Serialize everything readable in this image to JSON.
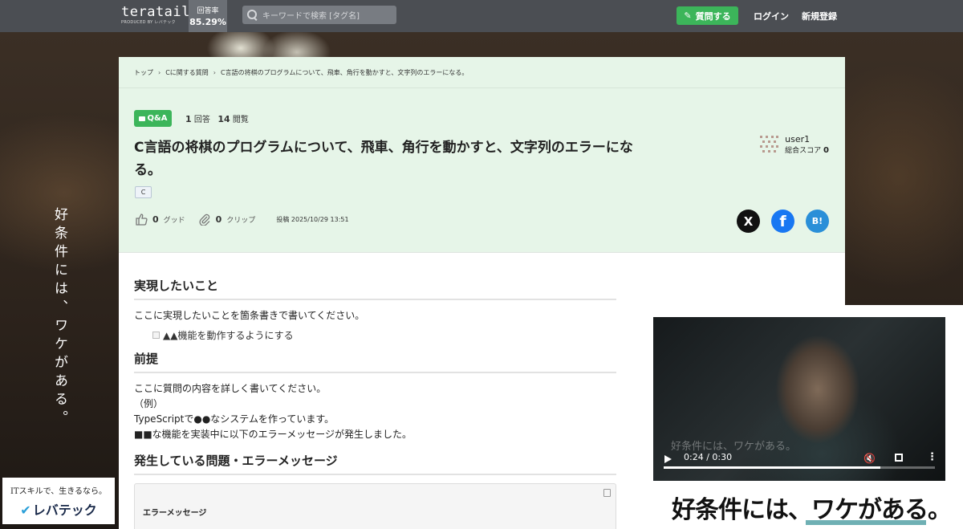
{
  "header": {
    "logo": "teratail",
    "logo_sub": "PRODUCED BY レバテック",
    "rate_label": "回答率",
    "rate_value": "85.29%",
    "search_placeholder": "キーワードで検索 [タグ名]",
    "ask_button": "質問する",
    "login": "ログイン",
    "signup": "新規登録"
  },
  "breadcrumb": [
    "トップ",
    "Cに関する質問",
    "C言語の将棋のプログラムについて、飛車、角行を動かすと、文字列のエラーになる。"
  ],
  "question": {
    "badge": "Q&A",
    "answers_count": "1",
    "answers_label": "回答",
    "views_count": "14",
    "views_label": "閲覧",
    "title": "C言語の将棋のプログラムについて、飛車、角行を動かすと、文字列のエラーになる。",
    "tag": "C",
    "good_count": "0",
    "good_label": "グッド",
    "clip_count": "0",
    "clip_label": "クリップ",
    "posted": "投稿 2025/10/29 13:51",
    "user_name": "user1",
    "user_score_label": "総合スコア",
    "user_score": "0"
  },
  "social": {
    "x": "X",
    "facebook": "f",
    "hatena": "B!"
  },
  "body": {
    "h_goal": "実現したいこと",
    "goal_text": "ここに実現したいことを箇条書きで書いてください。",
    "goal_item": "▲▲機能を動作するようにする",
    "h_premise": "前提",
    "premise_lines": [
      "ここに質問の内容を詳しく書いてください。",
      "（例）",
      "TypeScriptで●●なシステムを作っています。",
      "■■な機能を実装中に以下のエラーメッセージが発生しました。"
    ],
    "h_error": "発生している問題・エラーメッセージ",
    "code_label": "エラーメッセージ"
  },
  "ad": {
    "side_copy": "好条件には、ワケがある。",
    "logo_tagline": "ITスキルで、生きるなら。",
    "logo_name": "レバテック",
    "video_caption": "好条件には、ワケがある。",
    "video_time": "0:24 / 0:30",
    "video_progress": 0.8,
    "cta": "好条件には、ワケがある。"
  },
  "colors": {
    "brand_green": "#3cb55a",
    "header_bg": "#4b4e53",
    "question_bg": "#e6f5e8"
  }
}
